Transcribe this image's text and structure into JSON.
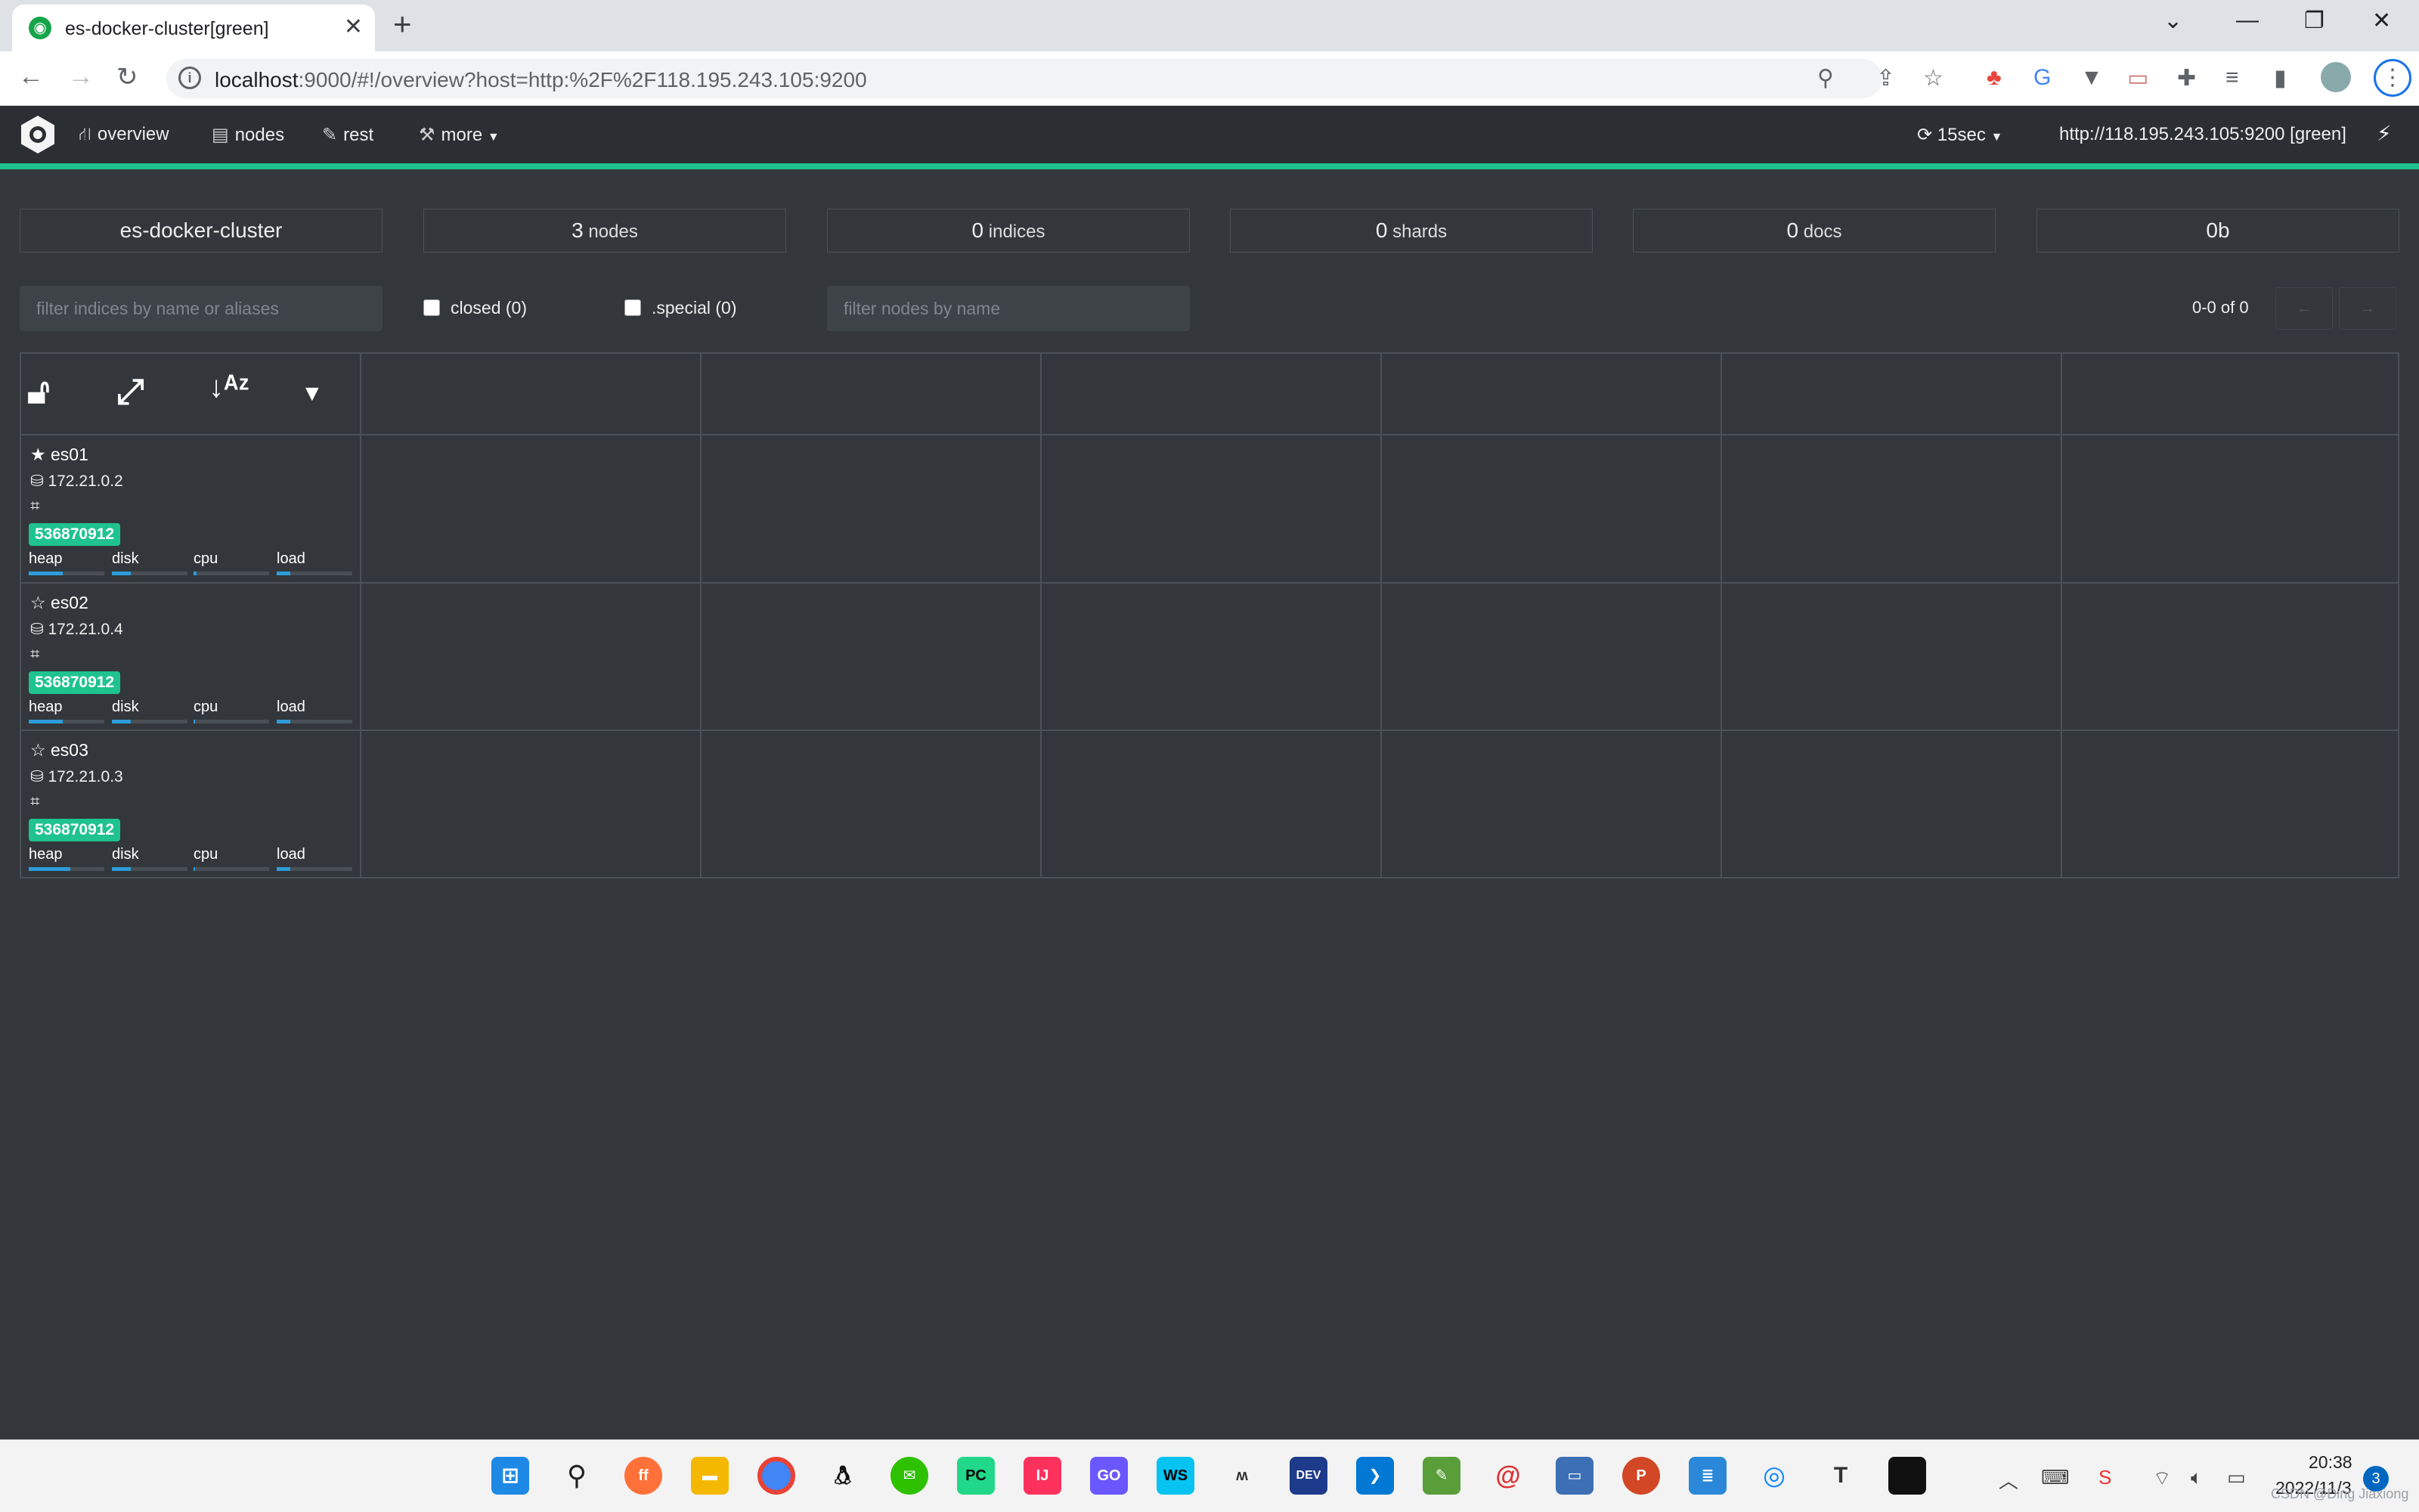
{
  "browser": {
    "tab_title": "es-docker-cluster[green]",
    "url_host": "localhost",
    "url_rest": ":9000/#!/overview?host=http:%2F%2F118.195.243.105:9200",
    "tab_close": "✕",
    "new_tab": "+",
    "win_minimize": "—",
    "win_restore": "❐",
    "win_close": "✕"
  },
  "nav": {
    "overview": "overview",
    "nodes": "nodes",
    "rest": "rest",
    "more": "more",
    "refresh": "15sec",
    "host": "http://118.195.243.105:9200 [green]"
  },
  "stats": {
    "cluster_name": "es-docker-cluster",
    "nodes_num": "3",
    "nodes_label": "nodes",
    "indices_num": "0",
    "indices_label": "indices",
    "shards_num": "0",
    "shards_label": "shards",
    "docs_num": "0",
    "docs_label": "docs",
    "size": "0b"
  },
  "filters": {
    "indices_placeholder": "filter indices by name or aliases",
    "closed_label": "closed (0)",
    "special_label": ".special (0)",
    "nodes_placeholder": "filter nodes by name",
    "pager": "0-0 of 0",
    "prev": "←",
    "next": "→"
  },
  "nodes": [
    {
      "name": "es01",
      "ip": "172.21.0.2",
      "badge": "536870912",
      "master": true,
      "metrics": {
        "heap": "heap",
        "disk": "disk",
        "cpu": "cpu",
        "load": "load"
      },
      "levels": {
        "heap": 0.45,
        "disk": 0.25,
        "cpu": 0.04,
        "load": 0.18
      }
    },
    {
      "name": "es02",
      "ip": "172.21.0.4",
      "badge": "536870912",
      "master": false,
      "metrics": {
        "heap": "heap",
        "disk": "disk",
        "cpu": "cpu",
        "load": "load"
      },
      "levels": {
        "heap": 0.45,
        "disk": 0.25,
        "cpu": 0.02,
        "load": 0.18
      }
    },
    {
      "name": "es03",
      "ip": "172.21.0.3",
      "badge": "536870912",
      "master": false,
      "metrics": {
        "heap": "heap",
        "disk": "disk",
        "cpu": "cpu",
        "load": "load"
      },
      "levels": {
        "heap": 0.55,
        "disk": 0.25,
        "cpu": 0.02,
        "load": 0.18
      }
    }
  ],
  "taskbar": {
    "time": "20:38",
    "date": "2022/11/3",
    "notifications": "3",
    "watermark": "CSDN @Ding Jiaxiong"
  },
  "colors": {
    "accent_green": "#1fc38d",
    "bar_blue": "#2d9cdb",
    "bg": "#33373b"
  }
}
